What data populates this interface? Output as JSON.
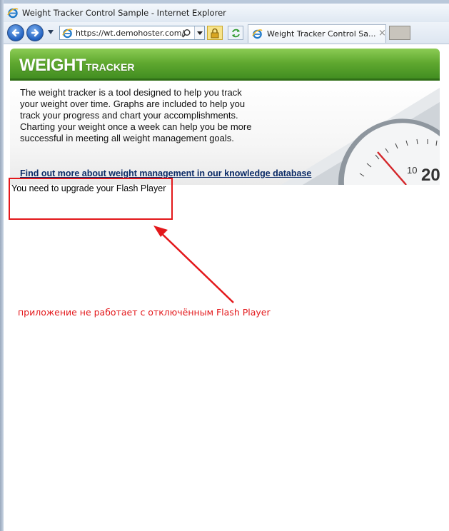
{
  "window": {
    "title": "Weight Tracker Control Sample - Internet Explorer"
  },
  "navbar": {
    "address_url": "https://wt.demohoster.com/",
    "tab_title": "Weight Tracker Control Sa...",
    "tab_close": "×",
    "icons": [
      "back-arrow",
      "forward-arrow",
      "dropdown-arrow",
      "ie-logo",
      "search",
      "lock",
      "refresh"
    ]
  },
  "weight_tracker": {
    "logo_main": "WEIGHT",
    "logo_sub": "TRACKER",
    "description": "The weight tracker is a tool designed to help you track your weight over time. Graphs are included to help you track your progress and chart your accomplishments. Charting your weight once a week can help you be more successful in meeting all weight management goals.",
    "link_text": "Find out more about weight management in our knowledge database",
    "scale_numbers": [
      "10",
      "20"
    ],
    "flash_message": "You need to upgrade your Flash Player"
  },
  "annotation": {
    "text": "приложение не работает с отключённым Flash Player"
  },
  "colors": {
    "header_green": "#5fa82f",
    "annotation_red": "#e3181b",
    "link_blue": "#0a2a66"
  }
}
